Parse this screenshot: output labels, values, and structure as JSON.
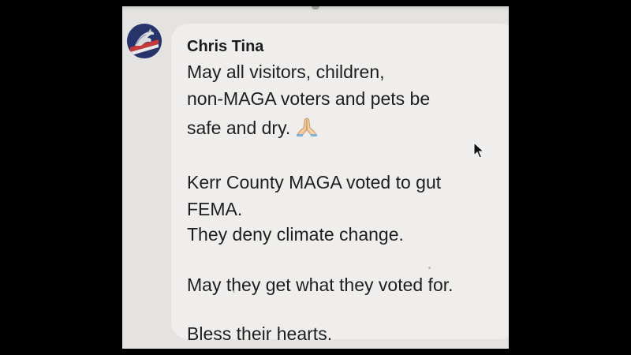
{
  "post": {
    "author": "Chris Tina",
    "lines": [
      "May all visitors, children,",
      "non-MAGA voters and pets be",
      "safe and dry.",
      "Kerr County MAGA voted to gut",
      "FEMA.",
      "They deny climate change.",
      "May they get what they voted for.",
      "Bless their hearts."
    ],
    "emoji_icon": "praying-hands-icon",
    "avatar_icon": "horse-flag-avatar-icon"
  },
  "colors": {
    "background": "#000000",
    "photo": "#e4e3e1",
    "bubble": "#efeeec",
    "text": "#1e1e1e",
    "avatar": "#27336b"
  }
}
